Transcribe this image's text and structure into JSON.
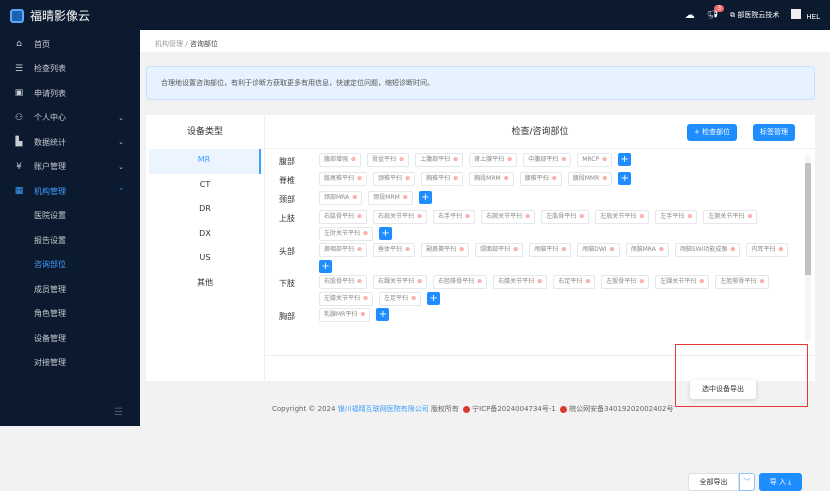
{
  "app": {
    "title": "福晴影像云",
    "notification_count": "3",
    "hospital": "部医院云技术",
    "user": "HEL"
  },
  "sidebar": {
    "items": [
      {
        "label": "首页",
        "icon": "home-icon",
        "glyph": "⌂"
      },
      {
        "label": "检查列表",
        "icon": "list-icon",
        "glyph": "☰"
      },
      {
        "label": "申请列表",
        "icon": "form-icon",
        "glyph": "▣"
      },
      {
        "label": "个人中心",
        "icon": "user-icon",
        "glyph": "⚇",
        "chevron": "⌄"
      },
      {
        "label": "数据统计",
        "icon": "chart-icon",
        "glyph": "▙",
        "chevron": "⌄"
      },
      {
        "label": "账户管理",
        "icon": "wallet-icon",
        "glyph": "¥",
        "chevron": "⌄"
      },
      {
        "label": "机构管理",
        "icon": "grid-icon",
        "glyph": "▦",
        "chevron": "⌃",
        "active": true
      }
    ],
    "sub_items": [
      {
        "label": "医院设置"
      },
      {
        "label": "报告设置"
      },
      {
        "label": "咨询部位",
        "active": true
      },
      {
        "label": "成员管理"
      },
      {
        "label": "角色管理"
      },
      {
        "label": "设备管理"
      },
      {
        "label": "对接管理"
      }
    ]
  },
  "breadcrumb": {
    "parent": "机构管理",
    "sep": "/",
    "current": "咨询部位"
  },
  "alert": "合理地设置咨询部位，有利于诊断方获取更多有用信息，快速定位问题，缩短诊断时间。",
  "devices": {
    "title": "设备类型",
    "items": [
      "MR",
      "CT",
      "DR",
      "DX",
      "US",
      "其他"
    ],
    "selected": "MR"
  },
  "parts": {
    "title": "检查/咨询部位",
    "add_label": "+ 检查部位",
    "tag_manage_label": "标签管理",
    "rows": [
      {
        "label": "腹部",
        "tags": [
          "腹部增强",
          "骨盆平扫",
          "上腹部平扫",
          "肾上腺平扫",
          "中腹部平扫",
          "MRCP"
        ]
      },
      {
        "label": "脊椎",
        "tags": [
          "骶尾椎平扫",
          "颈椎平扫",
          "胸椎平扫",
          "胸段MRM",
          "腰椎平扫",
          "腰段MMR"
        ]
      },
      {
        "label": "颈部",
        "tags": [
          "颈部MRA",
          "颈段MRM"
        ]
      },
      {
        "label": "上肢",
        "tags": [
          "右肱骨平扫",
          "右肩关节平扫",
          "右手平扫",
          "右腕关节平扫",
          "左肱骨平扫",
          "左肩关节平扫",
          "左手平扫",
          "左腕关节平扫",
          "左肘关节平扫"
        ]
      },
      {
        "label": "头部",
        "tags": [
          "鼻咽部平扫",
          "垂体平扫",
          "副鼻窦平扫",
          "颌面部平扫",
          "颅脑平扫",
          "颅脑DWI",
          "颅脑MRA",
          "颅脑SWI功能成像",
          "内耳平扫"
        ]
      },
      {
        "label": "下肢",
        "tags": [
          "右股骨平扫",
          "右踝关节平扫",
          "右胫腓骨平扫",
          "右膝关节平扫",
          "右足平扫",
          "左股骨平扫",
          "左踝关节平扫",
          "左胫腓骨平扫",
          "左膝关节平扫",
          "左足平扫"
        ]
      },
      {
        "label": "胸部",
        "tags": [
          "乳腺MR平扫"
        ]
      }
    ]
  },
  "actions": {
    "export_all": "全部导出",
    "import": "导 入 ⤓",
    "export_selected": "选中设备导出"
  },
  "footer": {
    "copyright": "Copyright © 2024",
    "company": "银川福晴互联网医院有限公司",
    "rights": "版权所有",
    "icp": "宁ICP备2024004734号-1",
    "police": "皖公网安备34019202002402号"
  },
  "colors": {
    "primary": "#1e8dff",
    "sidebar": "#0b1a2e",
    "highlight": "#e53935"
  }
}
